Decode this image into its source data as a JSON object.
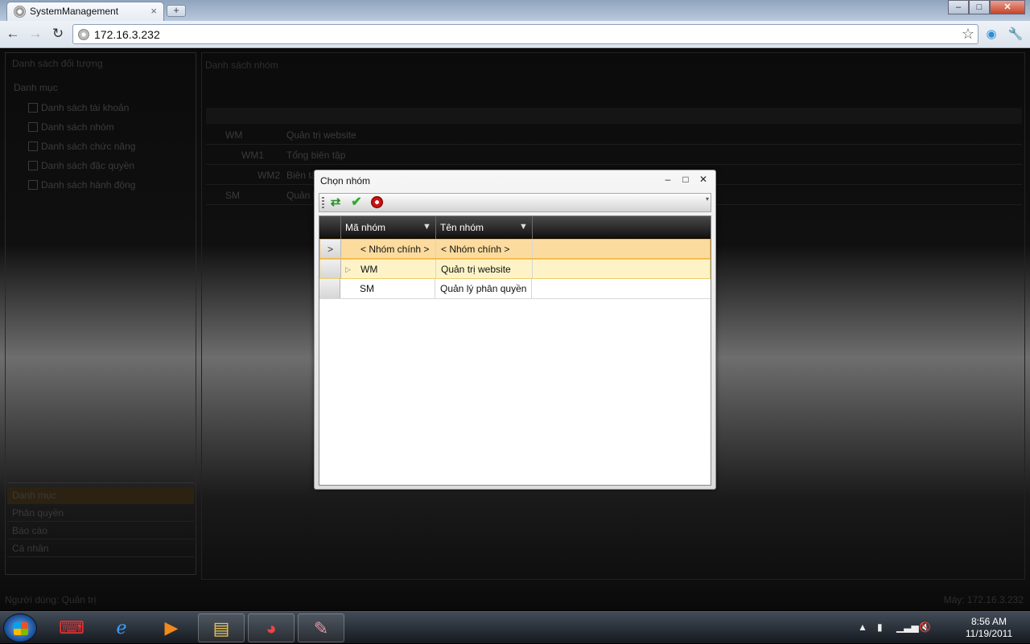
{
  "browser": {
    "tab_title": "SystemManagement",
    "tab_close": "×",
    "new_tab": "+",
    "url": "172.16.3.232",
    "back": "←",
    "forward": "→",
    "reload": "↻",
    "star": "☆",
    "minimize": "–",
    "maximize": "□",
    "close": "✕"
  },
  "background_app": {
    "left_title": "Danh sách đối tượng",
    "section": "Danh mục",
    "items": [
      {
        "label": "Danh sách tài khoản",
        "icon": "users-icon"
      },
      {
        "label": "Danh sách nhóm",
        "icon": "group-icon"
      },
      {
        "label": "Danh sách chức năng",
        "icon": "function-icon"
      },
      {
        "label": "Danh sách đặc quyền",
        "icon": "privilege-icon"
      },
      {
        "label": "Danh sách hành động",
        "icon": "action-icon"
      }
    ],
    "accordion": [
      "Danh mục",
      "Phân quyền",
      "Báo cáo",
      "Cá nhân"
    ],
    "right_title": "Danh sách nhóm",
    "rows": [
      {
        "code": "WM",
        "name": "Quản trị website"
      },
      {
        "code": "WM1",
        "name": "Tổng biên tập"
      },
      {
        "code": "WM2",
        "name": "Biên tập"
      },
      {
        "code": "SM",
        "name": "Quản lý"
      }
    ],
    "status_left": "Người dùng: Quản trị",
    "status_right": "Máy: 172.16.3.232"
  },
  "dialog": {
    "title": "Chọn nhóm",
    "ctrl_min": "–",
    "ctrl_max": "□",
    "ctrl_close": "✕",
    "columns": [
      {
        "label": "Mã nhóm"
      },
      {
        "label": "Tên nhóm"
      }
    ],
    "rows": [
      {
        "indicator": ">",
        "expander": "",
        "code": "< Nhóm chính >",
        "name": "< Nhóm chính >",
        "state": "selected"
      },
      {
        "indicator": "",
        "expander": "▷",
        "code": "WM",
        "name": "Quản trị website",
        "state": "hover"
      },
      {
        "indicator": "",
        "expander": "",
        "code": "SM",
        "name": "Quản lý phân quyền",
        "state": "normal"
      }
    ]
  },
  "taskbar": {
    "time": "8:56 AM",
    "date": "11/19/2011",
    "tray_up": "▲"
  }
}
